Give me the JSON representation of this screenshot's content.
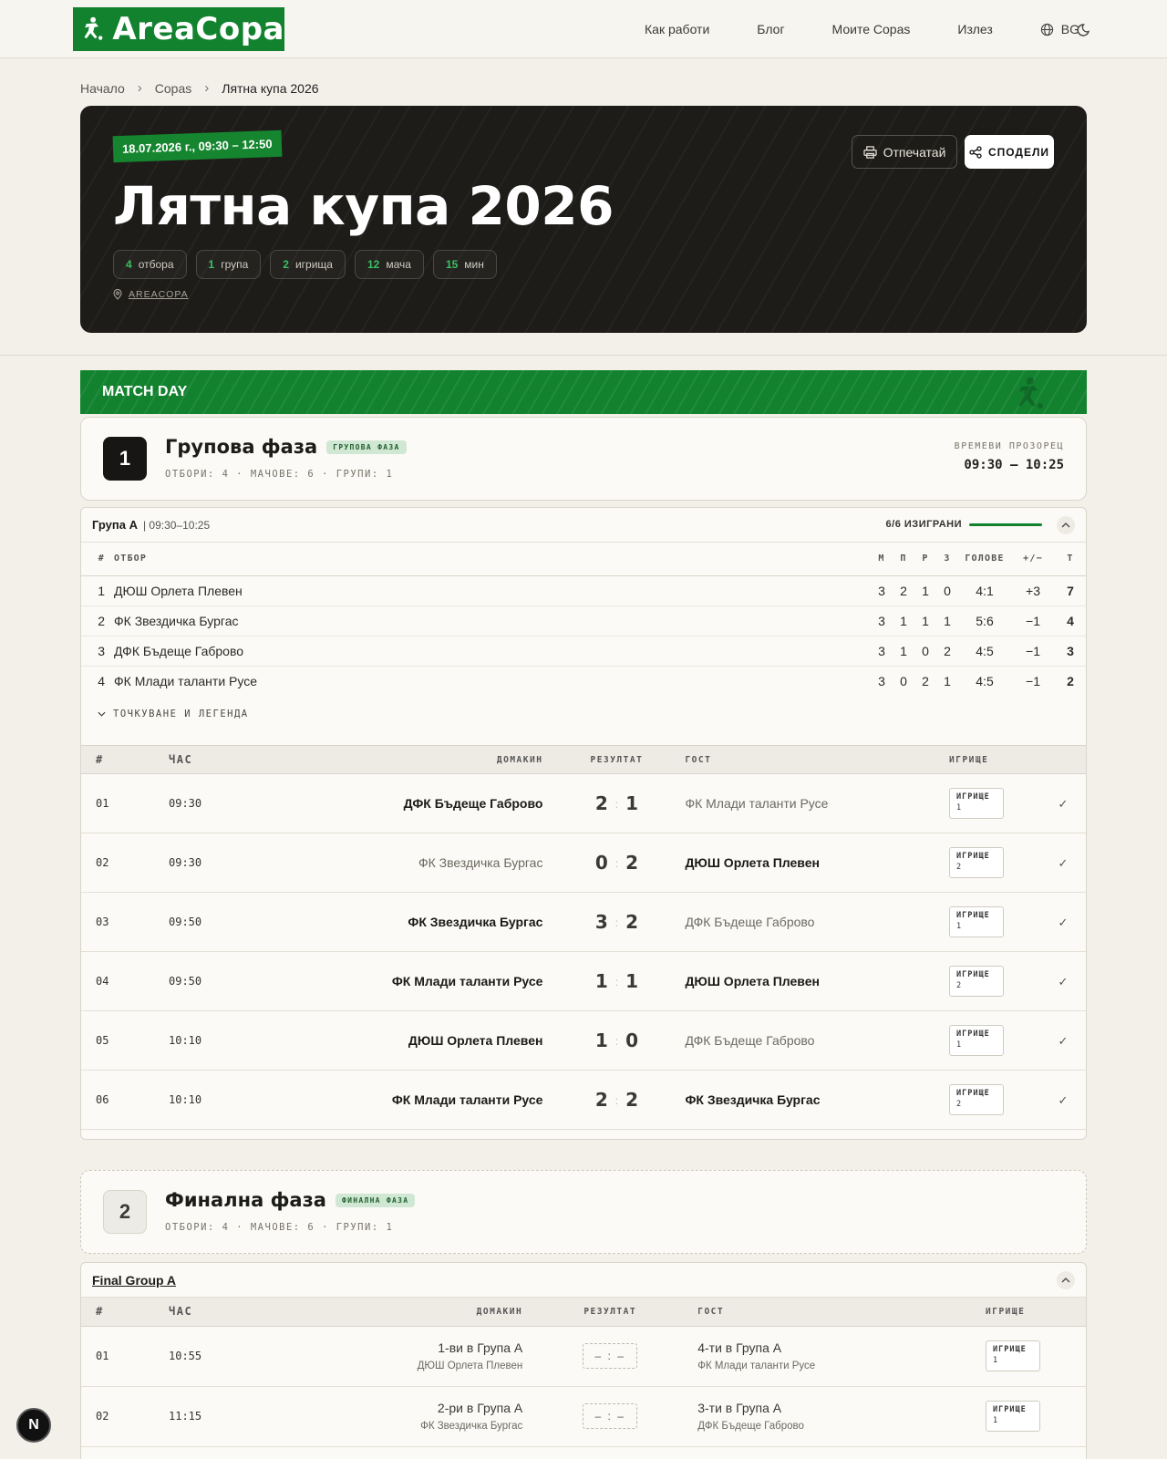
{
  "nav": {
    "logo_text": "AreaCopa",
    "links": [
      "Как работи",
      "Блог",
      "Моите Copas",
      "Излез"
    ],
    "lang": "BG"
  },
  "breadcrumb": [
    "Начало",
    "Copas",
    "Лятна купа 2026"
  ],
  "hero": {
    "date": "18.07.2026 г., 09:30 – 12:50",
    "title": "Лятна купа 2026",
    "stats": [
      {
        "num": "4",
        "label": "отбора"
      },
      {
        "num": "1",
        "label": "група"
      },
      {
        "num": "2",
        "label": "игрища"
      },
      {
        "num": "12",
        "label": "мача"
      },
      {
        "num": "15",
        "label": "мин"
      }
    ],
    "venue": "AREACOPA",
    "print_label": "Отпечатай",
    "share_label": "СПОДЕЛИ"
  },
  "matchday": {
    "label": "MATCH DAY"
  },
  "phase1": {
    "num": "1",
    "title": "Групова фаза",
    "badge": "ГРУПОВА ФАЗА",
    "meta": "ОТБОРИ: 4 · МАЧОВЕ: 6 · ГРУПИ: 1",
    "time_window_label": "ВРЕМЕВИ ПРОЗОРЕЦ",
    "time_window": "09:30 – 10:25"
  },
  "group_a": {
    "name": "Група A",
    "time": "| 09:30–10:25",
    "progress_label": "6/6 ИЗИГРАНИ",
    "progress": 1.0,
    "headers": {
      "rank": "#",
      "team": "ОТБОР",
      "m": "М",
      "w": "П",
      "d": "Р",
      "l": "З",
      "goals": "ГОЛОВЕ",
      "diff": "+/−",
      "pts": "Т"
    },
    "standings": [
      {
        "rank": "1",
        "team": "ДЮШ Орлета Плевен",
        "m": "3",
        "w": "2",
        "d": "1",
        "l": "0",
        "goals": "4:1",
        "diff": "+3",
        "pts": "7"
      },
      {
        "rank": "2",
        "team": "ФК Звездичка Бургас",
        "m": "3",
        "w": "1",
        "d": "1",
        "l": "1",
        "goals": "5:6",
        "diff": "−1",
        "pts": "4"
      },
      {
        "rank": "3",
        "team": "ДФК Бъдеще Габрово",
        "m": "3",
        "w": "1",
        "d": "0",
        "l": "2",
        "goals": "4:5",
        "diff": "−1",
        "pts": "3"
      },
      {
        "rank": "4",
        "team": "ФК Млади таланти Русе",
        "m": "3",
        "w": "0",
        "d": "2",
        "l": "1",
        "goals": "4:5",
        "diff": "−1",
        "pts": "2"
      }
    ],
    "legend_label": "ТОЧКУВАНЕ И ЛЕГЕНДА",
    "match_headers": {
      "idx": "#",
      "time": "ЧАС",
      "home": "ДОМАКИН",
      "result": "РЕЗУЛТАТ",
      "away": "ГОСТ",
      "court": "ИГРИЩЕ"
    },
    "matches": [
      {
        "idx": "01",
        "time": "09:30",
        "home": "ДФК Бъдеще Габрово",
        "hs": "2",
        "as": "1",
        "away": "ФК Млади таланти Русе",
        "court_label": "ИГРИЩЕ",
        "court": "1"
      },
      {
        "idx": "02",
        "time": "09:30",
        "home": "ФК Звездичка Бургас",
        "hs": "0",
        "as": "2",
        "away": "ДЮШ Орлета Плевен",
        "court_label": "ИГРИЩЕ",
        "court": "2"
      },
      {
        "idx": "03",
        "time": "09:50",
        "home": "ФК Звездичка Бургас",
        "hs": "3",
        "as": "2",
        "away": "ДФК Бъдеще Габрово",
        "court_label": "ИГРИЩЕ",
        "court": "1"
      },
      {
        "idx": "04",
        "time": "09:50",
        "home": "ФК Млади таланти Русе",
        "hs": "1",
        "as": "1",
        "away": "ДЮШ Орлета Плевен",
        "court_label": "ИГРИЩЕ",
        "court": "2"
      },
      {
        "idx": "05",
        "time": "10:10",
        "home": "ДЮШ Орлета Плевен",
        "hs": "1",
        "as": "0",
        "away": "ДФК Бъдеще Габрово",
        "court_label": "ИГРИЩЕ",
        "court": "1"
      },
      {
        "idx": "06",
        "time": "10:10",
        "home": "ФК Млади таланти Русе",
        "hs": "2",
        "as": "2",
        "away": "ФК Звездичка Бургас",
        "court_label": "ИГРИЩЕ",
        "court": "2"
      }
    ]
  },
  "phase2": {
    "num": "2",
    "title": "Финална фаза",
    "badge": "ФИНАЛНА ФАЗА",
    "meta": "ОТБОРИ: 4 · МАЧОВЕ: 6 · ГРУПИ: 1"
  },
  "final_group": {
    "name": "Final Group A",
    "headers": {
      "idx": "#",
      "time": "ЧАС",
      "home": "ДОМАКИН",
      "result": "РЕЗУЛТАТ",
      "away": "ГОСТ",
      "court": "ИГРИЩЕ"
    },
    "matches": [
      {
        "idx": "01",
        "time": "10:55",
        "home_slot": "1-ви в Група A",
        "home_team": "ДЮШ Орлета Плевен",
        "score": "– : –",
        "away_slot": "4-ти в Група A",
        "away_team": "ФК Млади таланти Русе",
        "court_label": "ИГРИЩЕ",
        "court": "1"
      },
      {
        "idx": "02",
        "time": "11:15",
        "home_slot": "2-ри в Група A",
        "home_team": "ФК Звездичка Бургас",
        "score": "– : –",
        "away_slot": "3-ти в Група A",
        "away_team": "ДФК Бъдеще Габрово",
        "court_label": "ИГРИЩЕ",
        "court": "1"
      }
    ]
  },
  "dev_badge": "N"
}
